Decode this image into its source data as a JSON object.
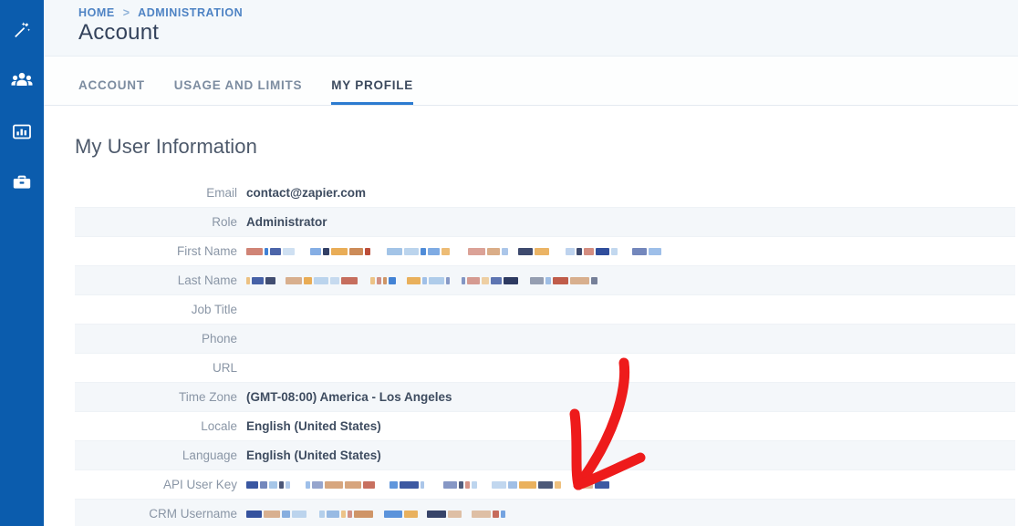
{
  "brand": {
    "sidebar_color": "#0B5CAD",
    "accent_color": "#2C7BD0",
    "annotation_color": "#EE1B1B"
  },
  "sidebar": {
    "items": [
      {
        "icon": "magic-wand-icon",
        "name": "sidebar-item-automations"
      },
      {
        "icon": "people-group-icon",
        "name": "sidebar-item-contacts"
      },
      {
        "icon": "chart-bar-icon",
        "name": "sidebar-item-reports"
      },
      {
        "icon": "briefcase-icon",
        "name": "sidebar-item-deals"
      }
    ]
  },
  "header": {
    "breadcrumb": {
      "home": "HOME",
      "separator": ">",
      "current": "ADMINISTRATION"
    },
    "title": "Account"
  },
  "tabs": [
    {
      "label": "ACCOUNT",
      "active": false
    },
    {
      "label": "USAGE AND LIMITS",
      "active": false
    },
    {
      "label": "MY PROFILE",
      "active": true
    }
  ],
  "section": {
    "title": "My User Information"
  },
  "info_table": {
    "rows": [
      {
        "label": "Email",
        "value": "contact@zapier.com",
        "redacted": false
      },
      {
        "label": "Role",
        "value": "Administrator",
        "redacted": false
      },
      {
        "label": "First Name",
        "value": "",
        "redacted": true
      },
      {
        "label": "Last Name",
        "value": "",
        "redacted": true
      },
      {
        "label": "Job Title",
        "value": "",
        "redacted": false
      },
      {
        "label": "Phone",
        "value": "",
        "redacted": false
      },
      {
        "label": "URL",
        "value": "",
        "redacted": false
      },
      {
        "label": "Time Zone",
        "value": "(GMT-08:00) America - Los Angeles",
        "redacted": false
      },
      {
        "label": "Locale",
        "value": "English (United States)",
        "redacted": false
      },
      {
        "label": "Language",
        "value": "English (United States)",
        "redacted": false
      },
      {
        "label": "API User Key",
        "value": "",
        "redacted": true
      },
      {
        "label": "CRM Username",
        "value": "",
        "redacted": true
      }
    ]
  },
  "annotation": {
    "name": "red-arrow-annotation",
    "shape": "hand-drawn-arrow-down-left"
  }
}
